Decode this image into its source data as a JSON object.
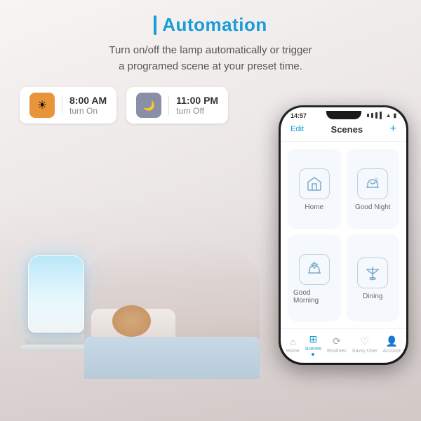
{
  "header": {
    "title": "Automation",
    "subtitle_line1": "Turn on/off the lamp automatically or trigger",
    "subtitle_line2": "a programed scene at your preset time."
  },
  "schedule": {
    "morning": {
      "time": "8:00 AM",
      "action": "turn On",
      "icon": "☀"
    },
    "night": {
      "time": "11:00 PM",
      "action": "turn Off",
      "icon": "🌙"
    }
  },
  "phone": {
    "status_time": "14:57",
    "header_edit": "Edit",
    "header_title": "Scenes",
    "header_plus": "+",
    "scenes": [
      {
        "label": "Home",
        "icon": "home"
      },
      {
        "label": "Good Night",
        "icon": "moon-bed"
      },
      {
        "label": "Good Morning",
        "icon": "sun-bed"
      },
      {
        "label": "Dining",
        "icon": "dining"
      }
    ],
    "nav": [
      {
        "label": "Home",
        "active": false
      },
      {
        "label": "Scenes",
        "active": true
      },
      {
        "label": "Routines",
        "active": false
      },
      {
        "label": "Savvy User",
        "active": false
      },
      {
        "label": "Account",
        "active": false
      }
    ]
  }
}
